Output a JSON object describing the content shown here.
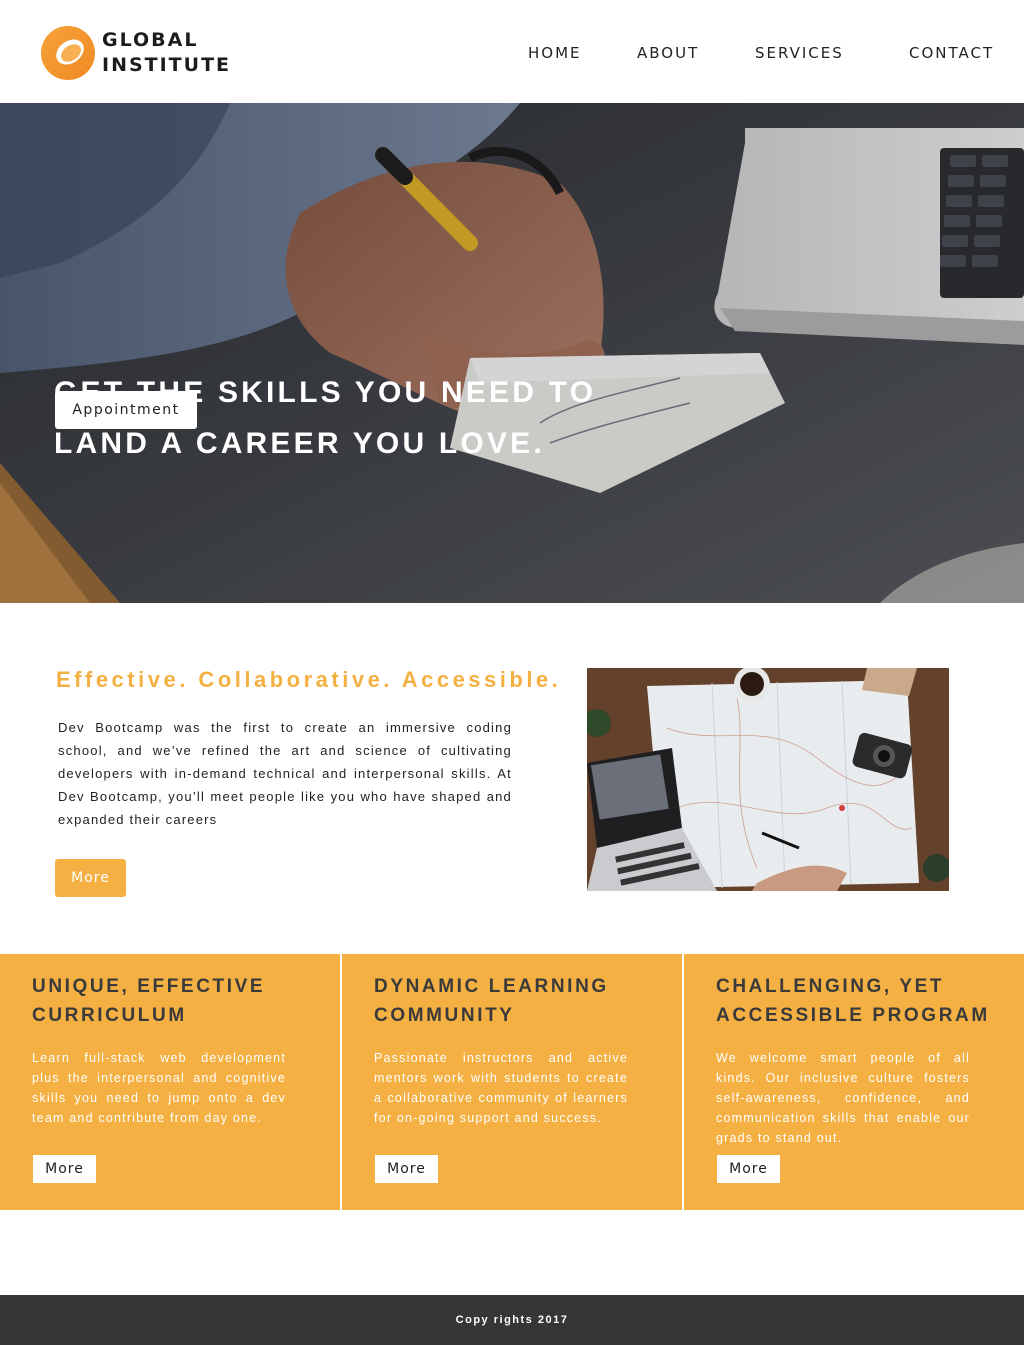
{
  "header": {
    "logo_line1": "GLOBAL",
    "logo_line2": "INSTITUTE",
    "logo_icon": "orange-ring-logo",
    "nav": [
      "HOME",
      "ABOUT",
      "SERVICES",
      "CONTACT"
    ]
  },
  "hero": {
    "title_line1": "GET THE SKILLS YOU NEED TO",
    "title_line2": "LAND A CAREER YOU LOVE.",
    "button_label": "Appointment"
  },
  "about": {
    "heading": "Effective. Collaborative. Accessible.",
    "text": "Dev Bootcamp was the first to create an immersive coding school, and we’ve refined the art and science of cultivating developers with in-demand technical and interpersonal skills. At Dev Bootcamp, you’ll meet people like you who have shaped and expanded their careers",
    "button_label": "More"
  },
  "features": [
    {
      "title_line1": "UNIQUE, EFFECTIVE",
      "title_line2": "CURRICULUM",
      "text": "Learn full-stack web development plus the interpersonal and cognitive skills you need to jump onto a dev team and contribute from day one.",
      "button_label": "More"
    },
    {
      "title_line1": "DYNAMIC LEARNING",
      "title_line2": "COMMUNITY",
      "text": "Passionate instructors and active mentors work with students to create a collaborative community of learners for on-going support and success.",
      "button_label": "More"
    },
    {
      "title_line1": "CHALLENGING, YET",
      "title_line2": "ACCESSIBLE PROGRAM",
      "text": "We welcome smart people of all kinds. Our inclusive culture fosters self-awareness, confidence, and communication skills that enable our grads to stand out.",
      "button_label": "More"
    }
  ],
  "footer": {
    "text": "Copy rights 2017"
  },
  "colors": {
    "accent": "#f4b043",
    "footer_bg": "#363636",
    "title_dark": "#3a3a3a"
  }
}
